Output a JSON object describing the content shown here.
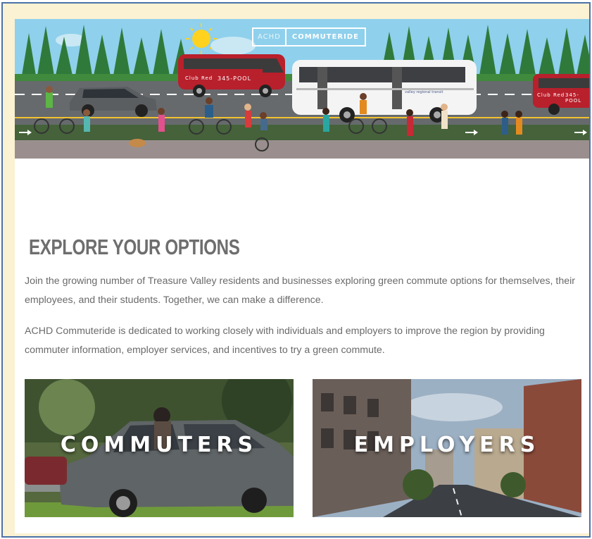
{
  "hero": {
    "logo_left": "ACHD",
    "logo_right": "COMMUTERIDE",
    "van_label": "345-POOL",
    "van_brand": "Club Red",
    "bus_brand": "valley regional transit"
  },
  "section": {
    "heading": "EXPLORE YOUR OPTIONS",
    "paragraph_1": "Join the growing number of Treasure Valley residents and businesses exploring green commute options for themselves, their employees, and their students. Together, we can make a difference.",
    "paragraph_2": "ACHD Commuteride is dedicated to working closely with individuals and employers to improve the region by providing commuter information, employer services, and incentives to try a green commute."
  },
  "tiles": [
    {
      "label": "COMMUTERS"
    },
    {
      "label": "EMPLOYERS"
    }
  ],
  "colors": {
    "frame_border": "#4a72a8",
    "frame_background": "#fbf1d3",
    "heading": "#6e6e6e",
    "body_text": "#6a6a6a",
    "van_red": "#b8202c",
    "sky": "#8fd0ec"
  }
}
